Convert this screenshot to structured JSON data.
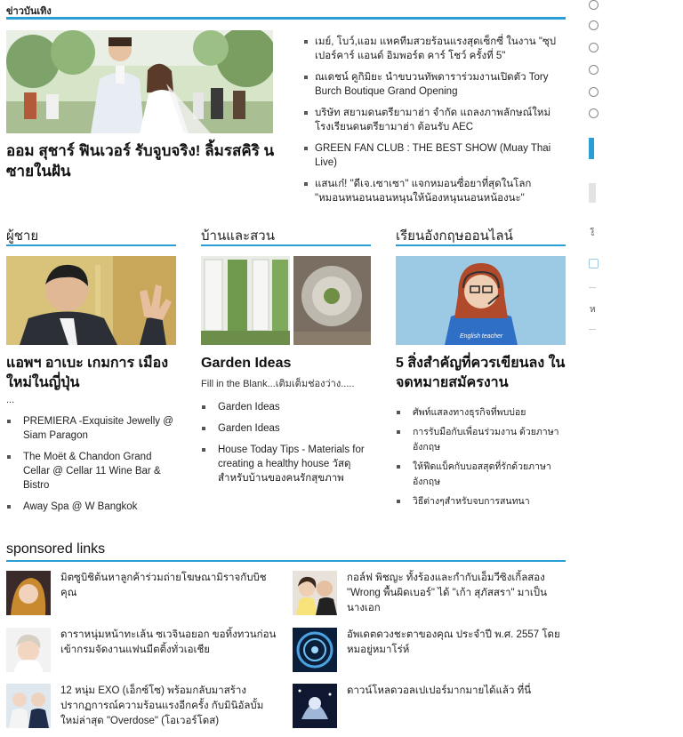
{
  "top": {
    "section_title": "ข่าวบันเทิง",
    "hero_headline": "ออม สุชาร์ ฟินเวอร์ รับจูบจริง! ลิ้มรสคิริ นซายในฝัน",
    "news": [
      "เมย์, โบว์,แอม แหคทีมสวยร้อนแรงสุดเซ็กซี่ ในงาน \"ซุปเปอร์คาร์ แอนด์ อิมพอร์ต คาร์ โชว์ ครั้งที่ 5\"",
      "ณเดชน์ คูกิมิยะ นำขบวนทัพดาราร่วมงานเปิดตัว Tory Burch Boutique Grand Opening",
      "บริษัท สยามดนตรียามาฮ่า จำกัด แถลงภาพลักษณ์ใหม่ โรงเรียนดนตรียามาฮ่า ต้อนรับ AEC",
      "GREEN FAN CLUB : THE BEST SHOW (Muay Thai Live)",
      "แสนเก๋! \"ดีเจ.เซาเซา\" แจกหมอนซื่อยาที่สุดในโลก \"หมอนหนอนนอนหนุนให้น้องหนุนนอนหน้องนะ\""
    ]
  },
  "columns": [
    {
      "title": "ผู้ชาย",
      "headline": "แอพฯ อาเบะ เกมการ เมืองใหม่ในญี่ปุ่น",
      "sub": "...",
      "items": [
        "PREMIERA -Exquisite Jewelly @ Siam Paragon",
        "The Moët & Chandon Grand Cellar @ Cellar 11 Wine Bar & Bistro",
        "Away Spa @ W Bangkok"
      ]
    },
    {
      "title": "บ้านและสวน",
      "headline": "Garden Ideas",
      "sub": "Fill in the Blank...เติมเต็มช่องว่าง.....",
      "items": [
        "Garden Ideas",
        "Garden Ideas",
        "House Today Tips - Materials for creating a healthy house วัสดุสำหรับบ้านของคนรักสุขภาพ"
      ]
    },
    {
      "title": "เรียนอังกฤษออนไลน์",
      "headline": "5 สิ่งสำคัญที่ควรเขียนลง ในจดหมายสมัครงาน",
      "sub": "",
      "teacher_label": "English teacher",
      "items": [
        "ศัพท์แสลงทางธุรกิจที่พบบ่อย",
        "การรับมือกับเพื่อนร่วมงาน ด้วยภาษาอังกฤษ",
        "ให้ฟีดแบ็คกับบอสสุดที่รักด้วยภาษาอังกฤษ",
        "วิธีต่างๆสำหรับจบการสนทนา"
      ]
    }
  ],
  "sponsored": {
    "title": "sponsored links",
    "items": [
      "มิตซูบิชิต้นหาลูกค้าร่วมถ่ายโฆษณามิราจกับบิชคุณ",
      "กอล์ฟ พิชญะ ทั้งร้องและกำกับเอ็มวีซิงเกิ้ลสอง \"Wrong พื้นผิดเบอร์\" ได้ \"เก้า สุภัสสรา\" มาเป็นนางเอก",
      "ดาราหนุ่มหน้าทะเล้น ซเวจินอยอก ขอทิ้งทวนก่อนเข้ากรมจัดงานแฟนมีตติ้งทั่วเอเชีย",
      "อัพเดตดวงชะตาของคุณ ประจำปี พ.ศ. 2557 โดยหมอยู่หมาโร่ห์",
      "12 หนุ่ม EXO (เอ็กซ์โซ) พร้อมกลับมาสร้างปรากฏการณ์ความร้อนแรงอีกครั้ง กับมินิอัลบั้มใหม่ล่าสุด \"Overdose\" (โอเวอร์โดส)",
      "ดาวน์โหลดวอลเปเปอร์มากมายได้แล้ว ที่นี่"
    ]
  },
  "sidebar": {
    "char1": "รู",
    "char2": "ห"
  },
  "colors": {
    "accent": "#2a9fd6"
  }
}
